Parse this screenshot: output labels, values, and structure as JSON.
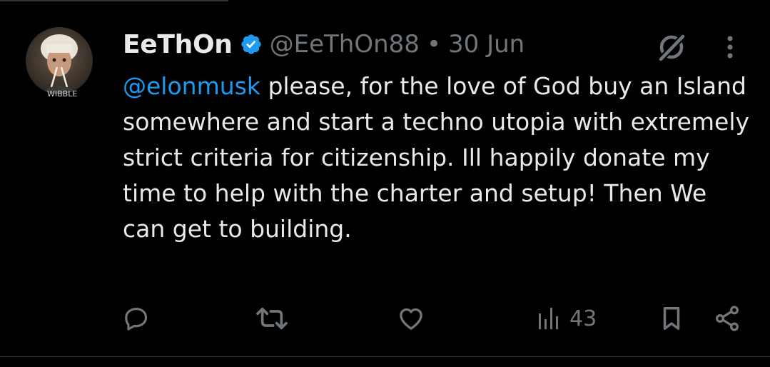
{
  "tweet": {
    "author": {
      "display_name": "EeThOn",
      "handle": "@EeThOn88",
      "verified": true,
      "avatar_caption": "WIBBLE"
    },
    "separator": "•",
    "timestamp": "30 Jun",
    "mention": "@elonmusk",
    "text": " please, for the love of God buy an Island somewhere and start a techno utopia with extremely strict criteria for citizenship. Ill happily donate my time to help with the charter and setup! Then We can get to building.",
    "views": "43"
  },
  "icons": {
    "verified": "verified-badge-icon",
    "grok": "grok-icon",
    "more": "more-options-icon",
    "reply": "reply-icon",
    "repost": "repost-icon",
    "like": "like-icon",
    "views": "views-icon",
    "bookmark": "bookmark-icon",
    "share": "share-icon"
  },
  "colors": {
    "background": "#000000",
    "text": "#e7e9ea",
    "muted": "#71767b",
    "accent": "#1d9bf0",
    "divider": "#2f3336"
  }
}
